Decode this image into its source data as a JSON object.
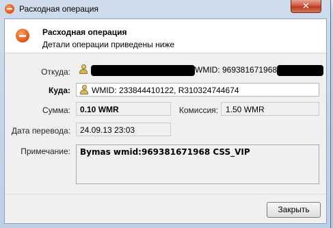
{
  "window": {
    "title": "Расходная операция",
    "close_glyph": "✕"
  },
  "header": {
    "title": "Расходная операция",
    "subtitle": "Детали операции приведены ниже",
    "icon": "minus-circle-icon"
  },
  "fields": {
    "from_label": "Откуда:",
    "from_value": "WMID: 969381671968,",
    "to_label": "Куда:",
    "to_value": "WMID: 233844410122, R310324744674",
    "amount_label": "Сумма:",
    "amount_value": "0.10 WMR",
    "commission_label": "Комиссия:",
    "commission_value": "1.50 WMR",
    "date_label": "Дата перевода:",
    "date_value": "24.09.13 23:03",
    "note_label": "Примечание:",
    "note_value": "Bymas wmid:969381671968 CSS_VIP"
  },
  "buttons": {
    "close_label": "Закрыть"
  },
  "colors": {
    "accent_orange": "#e2501a",
    "close_red": "#c44a2e",
    "dialog_bg": "#f0f0f0"
  }
}
